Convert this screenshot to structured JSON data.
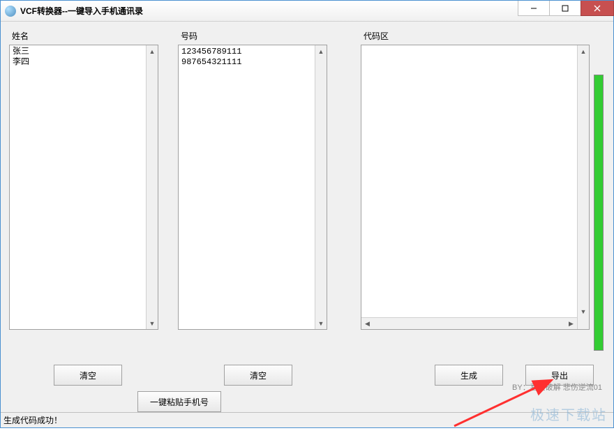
{
  "window": {
    "title": "VCF转换器--一键导入手机通讯录"
  },
  "labels": {
    "name": "姓名",
    "number": "号码",
    "code": "代码区"
  },
  "data": {
    "names": "张三\n李四",
    "numbers": "123456789111\n987654321111",
    "code": ""
  },
  "buttons": {
    "clear1": "清空",
    "clear2": "清空",
    "paste": "一键粘贴手机号",
    "generate": "生成",
    "export": "导出"
  },
  "credit": "BY：喜爱破解 悲伤逆流01",
  "status": "生成代码成功！",
  "watermark": "极速下载站"
}
